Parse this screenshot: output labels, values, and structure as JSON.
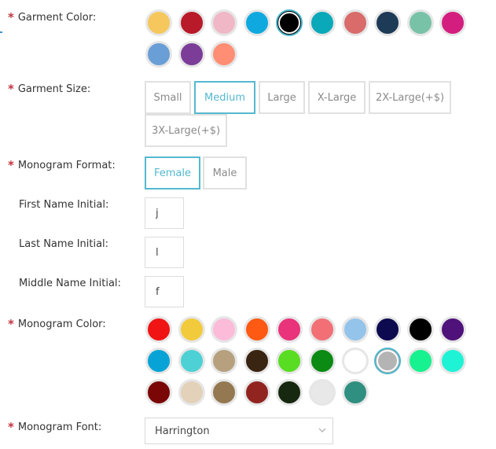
{
  "garment_color": {
    "label": "Garment Color:",
    "swatches": [
      "#f5c75c",
      "#b81a2a",
      "#f0b8c6",
      "#0fa9e0",
      "#000000",
      "#0aa9b9",
      "#d96b6b",
      "#1d3a57",
      "#78c3a7",
      "#d41e7f",
      "#6a9ed6",
      "#7c3d98",
      "#ff8e74"
    ],
    "selected_index": 4
  },
  "garment_size": {
    "label": "Garment Size:",
    "options": [
      "Small",
      "Medium",
      "Large",
      "X-Large",
      "2X-Large(+$)",
      "3X-Large(+$)"
    ],
    "selected": "Medium"
  },
  "monogram_format": {
    "label": "Monogram Format:",
    "options": [
      "Female",
      "Male"
    ],
    "selected": "Female"
  },
  "first_initial": {
    "label": "First Name Initial:",
    "value": "j"
  },
  "last_initial": {
    "label": "Last Name Initial:",
    "value": "l"
  },
  "middle_initial": {
    "label": "Middle Name Initial:",
    "value": "f"
  },
  "monogram_color": {
    "label": "Monogram Color:",
    "swatches": [
      "#f01414",
      "#f2cb3c",
      "#fbbbd9",
      "#fe5a13",
      "#e9337a",
      "#f26f76",
      "#94c4ea",
      "#0d0a4f",
      "#000000",
      "#4f127a",
      "#08a3d6",
      "#4dd1d4",
      "#b6a07e",
      "#3a2412",
      "#59dd23",
      "#0b8a14",
      "#ffffff",
      "#b4b4b4",
      "#18f18f",
      "#1ff3d5",
      "#7a0606",
      "#e3d1ba",
      "#937851",
      "#922420",
      "#16280f",
      "#e8e8e8",
      "#2f8f80"
    ],
    "selected_index": 17
  },
  "monogram_font": {
    "label": "Monogram Font:",
    "value": "Harrington"
  }
}
